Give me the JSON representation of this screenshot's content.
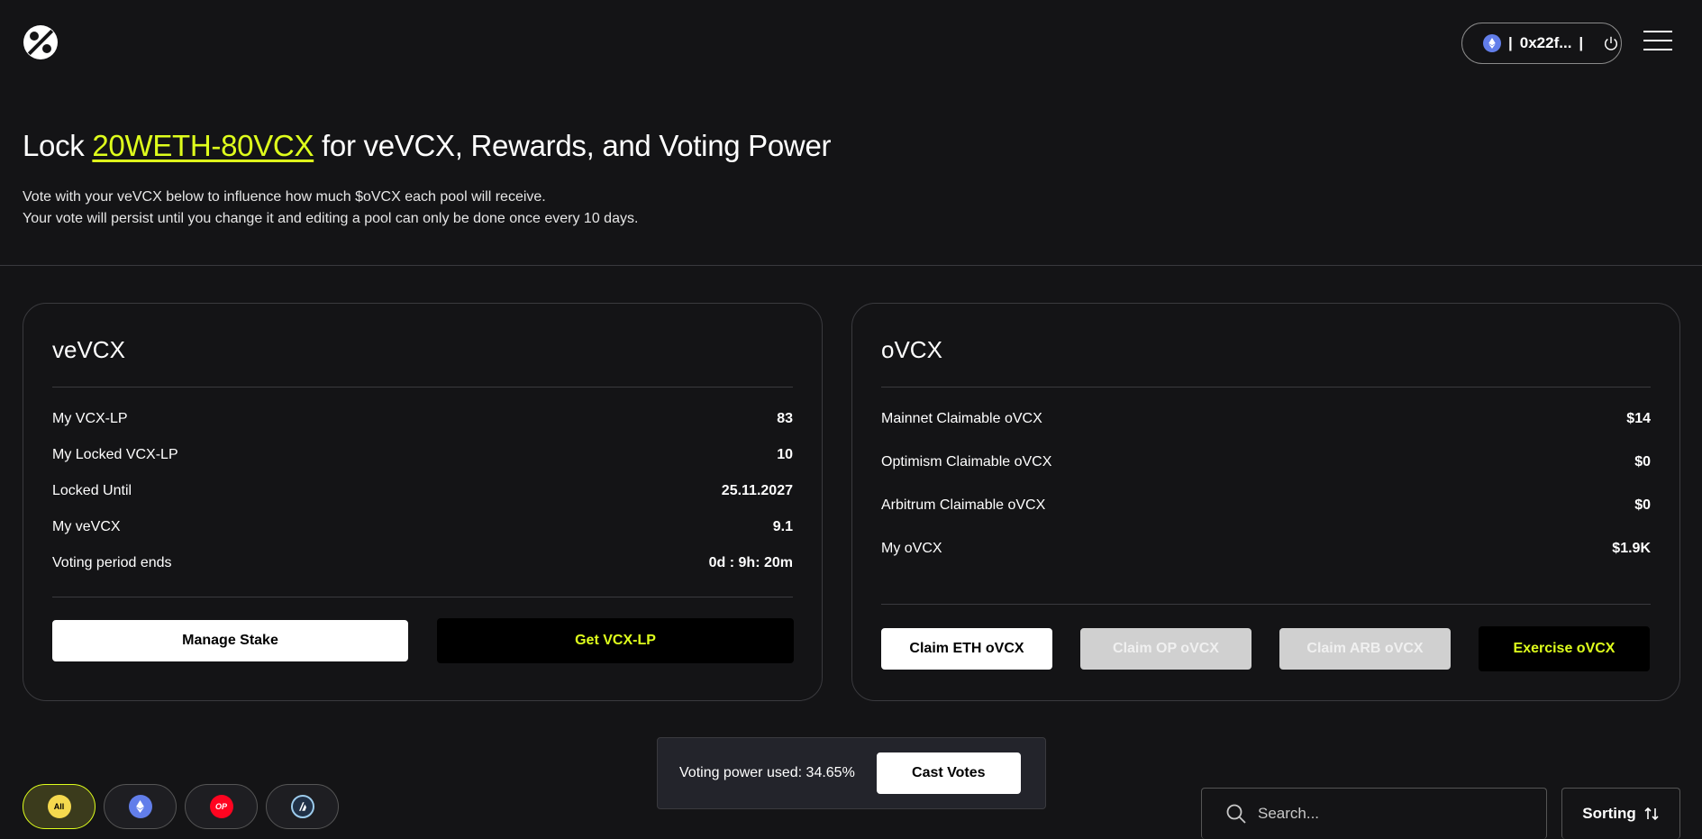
{
  "header": {
    "wallet_address": "0x22f...",
    "wallet_separator_left": "|",
    "wallet_separator_right": "|",
    "chain_icon": "ethereum-icon"
  },
  "hero": {
    "title_prefix": "Lock ",
    "title_token": "20WETH-80VCX",
    "title_suffix": " for veVCX, Rewards, and Voting Power",
    "subtitle_line1": "Vote with your veVCX below to influence how much $oVCX each pool will receive.",
    "subtitle_line2": "Your vote will persist until you change it and editing a pool can only be done once every 10 days."
  },
  "vevcx_card": {
    "title": "veVCX",
    "rows": [
      {
        "label": "My VCX-LP",
        "value": "83"
      },
      {
        "label": "My Locked VCX-LP",
        "value": "10"
      },
      {
        "label": "Locked Until",
        "value": "25.11.2027"
      },
      {
        "label": "My veVCX",
        "value": "9.1"
      },
      {
        "label": "Voting period ends",
        "value": "0d : 9h: 20m"
      }
    ],
    "manage_button": "Manage Stake",
    "get_lp_button": "Get VCX-LP"
  },
  "ovcx_card": {
    "title": "oVCX",
    "rows": [
      {
        "label": "Mainnet Claimable oVCX",
        "value": "$14"
      },
      {
        "label": "Optimism Claimable oVCX",
        "value": "$0"
      },
      {
        "label": "Arbitrum Claimable oVCX",
        "value": "$0"
      },
      {
        "label": "My oVCX",
        "value": "$1.9K"
      }
    ],
    "claim_eth_button": "Claim ETH oVCX",
    "claim_op_button": "Claim OP oVCX",
    "claim_arb_button": "Claim ARB oVCX",
    "exercise_button": "Exercise oVCX"
  },
  "filters": {
    "all_label": "All",
    "op_label": "OP",
    "items": [
      "all-chains",
      "ethereum",
      "optimism",
      "arbitrum"
    ]
  },
  "voting": {
    "power_used_label": "Voting power used: 34.65%",
    "cast_button": "Cast Votes"
  },
  "search": {
    "placeholder": "Search..."
  },
  "sorting": {
    "label": "Sorting"
  },
  "colors": {
    "background": "#141416",
    "accent": "#dfff1c",
    "ethereum": "#627eea",
    "optimism": "#ff0420",
    "arbitrum": "#213147"
  }
}
